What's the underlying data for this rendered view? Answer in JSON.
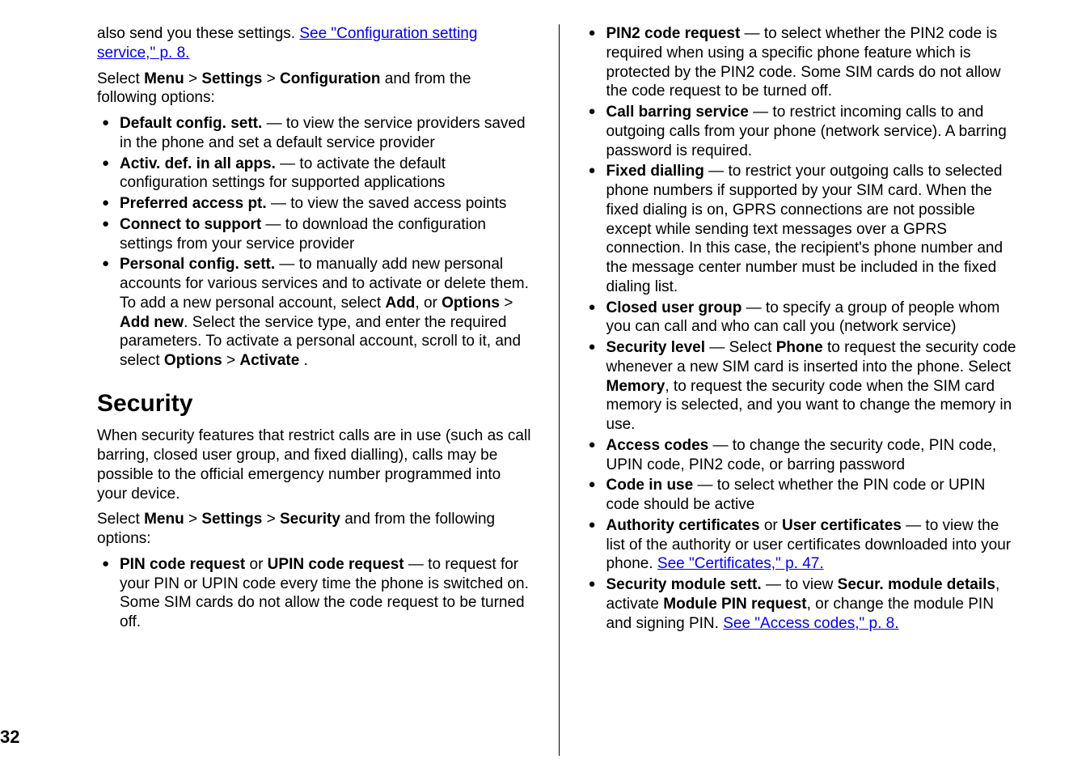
{
  "page_number": "32",
  "left": {
    "intro_prefix": "also send you these settings. ",
    "intro_link": "See \"Configuration setting service,\" p. 8.",
    "select_prefix": "Select ",
    "select_menu": "Menu",
    "gt": " > ",
    "select_settings": "Settings",
    "select_config": "Configuration",
    "select_suffix": " and from the following options:",
    "items": [
      {
        "label": "Default config. sett.",
        "desc": "  — to view the service providers saved in the phone and set a default service provider"
      },
      {
        "label": "Activ. def. in all apps.",
        "desc": "  — to activate the default configuration settings for supported applications"
      },
      {
        "label": "Preferred access pt.",
        "desc": "  — to view the saved access points"
      },
      {
        "label": "Connect to support",
        "desc": "  — to download the configuration settings from your service provider"
      }
    ],
    "personal": {
      "label": "Personal config. sett.",
      "desc1": "  — to manually add new personal accounts for various services and to activate or delete them. To add a new personal account, select ",
      "add": "Add",
      "or": ", or ",
      "options": "Options",
      "addnew": "Add new",
      "desc2": ". Select the service type, and enter the required parameters. To activate a personal account, scroll to it, and select ",
      "options2": "Options",
      "activate": "Activate",
      "dot": " ."
    },
    "security_heading": "Security",
    "security_p1": "When security features that restrict calls are in use (such as call barring, closed user group, and fixed dialling), calls may be possible to the official emergency number programmed into your device.",
    "sec_select_prefix": "Select ",
    "sec_menu": "Menu",
    "sec_settings": "Settings",
    "sec_security": "Security",
    "sec_suffix": " and from the following options:",
    "pin_label1": "PIN code request",
    "pin_or": " or ",
    "pin_label2": "UPIN code request",
    "pin_desc": " — to request for your PIN or UPIN code every time the phone is switched on. Some SIM cards do not allow the code request to be turned off."
  },
  "right": {
    "items_simple": [
      {
        "label": "PIN2 code request",
        "desc": "  — to select whether the PIN2 code is required when using a specific phone feature which is protected by the PIN2 code. Some SIM cards do not allow the code request to be turned off."
      },
      {
        "label": "Call barring service",
        "desc": "  — to restrict incoming calls to and outgoing calls from your phone (network service). A barring password is required."
      },
      {
        "label": "Fixed dialling",
        "desc": "  — to restrict your outgoing calls to selected phone numbers if supported by your SIM card. When the fixed dialing is on, GPRS connections are not possible except while sending text messages over a GPRS connection. In this case, the recipient's phone number and the message center number must be included in the fixed dialing list."
      },
      {
        "label": "Closed user group",
        "desc": "  — to specify a group of people whom you can call and who can call you (network service)"
      }
    ],
    "security_level": {
      "label": "Security level",
      "pre": "  — Select ",
      "phone": "Phone",
      "mid": " to request the security code whenever a new SIM card is inserted into the phone. Select ",
      "memory": "Memory",
      "post": ", to request the security code when the SIM card memory is selected, and you want to change the memory in use."
    },
    "access_codes": {
      "label": "Access codes",
      "desc": "  — to change the security code, PIN code, UPIN code, PIN2 code, or barring password"
    },
    "code_in_use": {
      "label": "Code in use",
      "desc": "  — to select whether the PIN code or UPIN code should be active"
    },
    "certs": {
      "label1": "Authority certificates",
      "or": " or ",
      "label2": "User certificates",
      "desc": " — to view the list of the authority or user certificates downloaded into your phone. ",
      "link": "See \"Certificates,\" p. 47."
    },
    "secmod": {
      "label": "Security module sett.",
      "pre": "  — to view ",
      "details": "Secur. module details",
      "mid": ", activate ",
      "pinreq": "Module PIN request",
      "post": ", or change the module PIN and signing PIN. ",
      "link": "See \"Access codes,\" p. 8."
    }
  }
}
